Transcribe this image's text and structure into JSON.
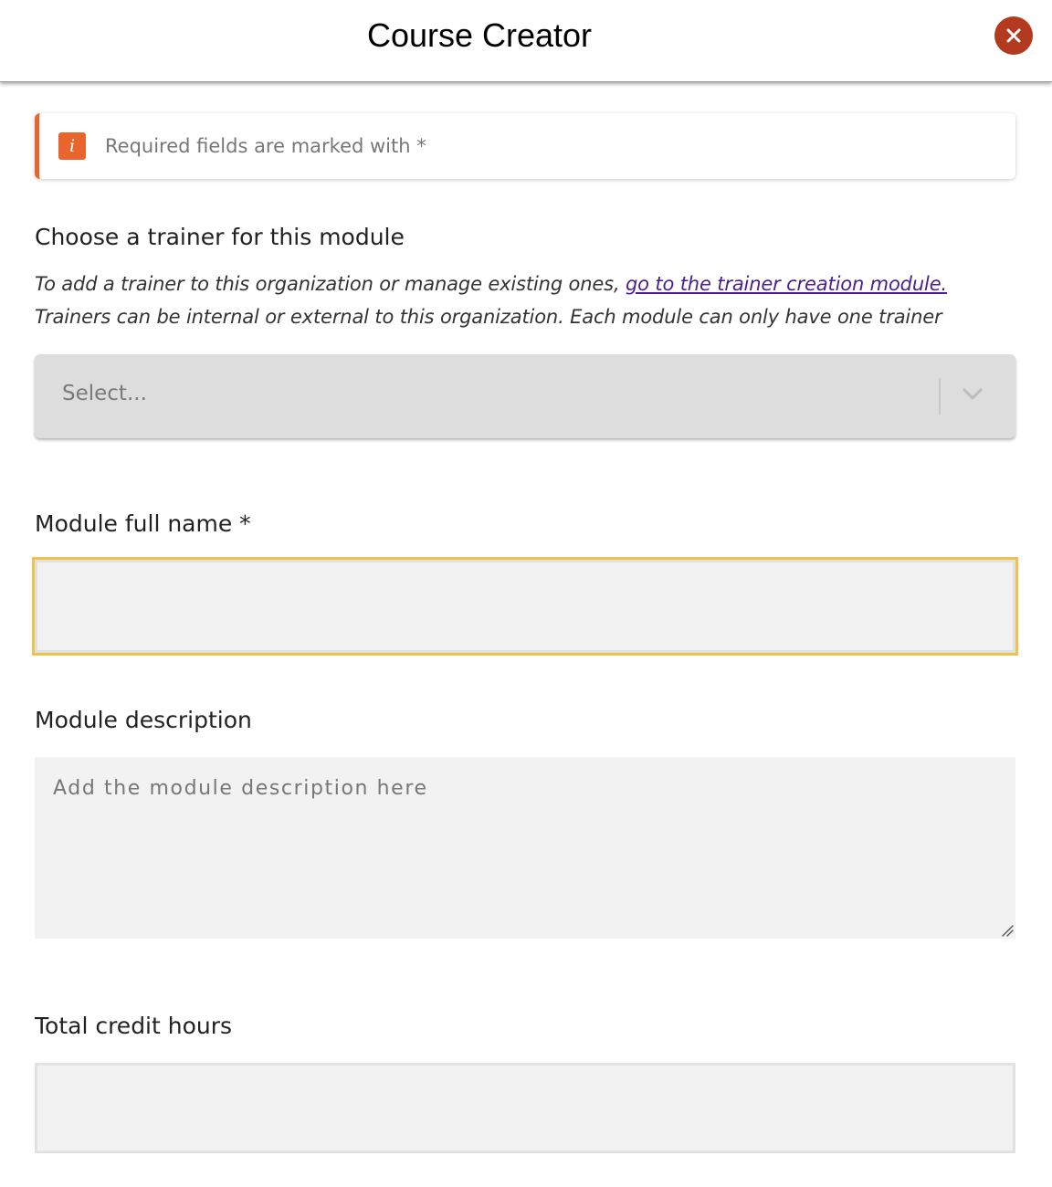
{
  "header": {
    "title": "Course Creator",
    "close_label": "x"
  },
  "notice": {
    "icon_text": "i",
    "text": "Required fields are marked with *"
  },
  "trainer": {
    "label": "Choose a trainer for this module",
    "help_line1_prefix": "To add a trainer to this organization or manage existing ones, ",
    "help_link": "go to the trainer creation module.",
    "help_line2": "Trainers can be internal or external to this organization. Each module can only have one trainer",
    "select_placeholder": "Select..."
  },
  "module_name": {
    "label": "Module full name *",
    "value": ""
  },
  "module_description": {
    "label": "Module description",
    "placeholder": "Add the module description here"
  },
  "credit_hours": {
    "label": "Total credit hours",
    "value": ""
  },
  "colors": {
    "accent": "#e8662d",
    "close": "#b43a1f",
    "focus": "#efc24e",
    "link": "#4b1f8e"
  },
  "icons": {
    "close": "close-icon",
    "info": "info-icon",
    "dropdown": "chevron-down-icon",
    "resize": "resize-handle-icon"
  }
}
